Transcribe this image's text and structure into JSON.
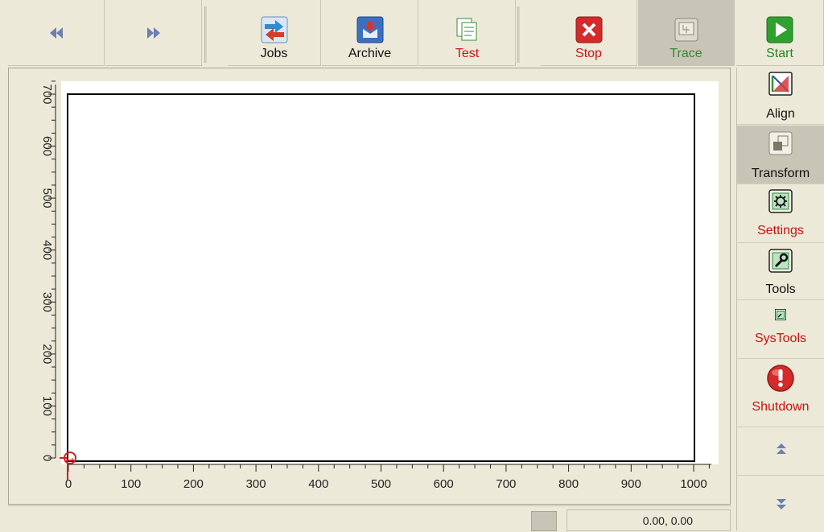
{
  "toolbar": {
    "buttons": [
      {
        "label": "Jobs",
        "color": "#111111",
        "icon": "jobs-icon"
      },
      {
        "label": "Archive",
        "color": "#111111",
        "icon": "archive-icon"
      },
      {
        "label": "Test",
        "color": "#cc1111",
        "icon": "test-icon"
      },
      {
        "label": "Stop",
        "color": "#cc1111",
        "icon": "stop-icon"
      },
      {
        "label": "Trace",
        "color": "#338833",
        "icon": "trace-icon"
      },
      {
        "label": "Start",
        "color": "#228822",
        "icon": "start-icon"
      }
    ],
    "nav": [
      "rewind-icon",
      "fast-forward-icon"
    ]
  },
  "side": {
    "buttons": [
      {
        "label": "Align",
        "color": "#111111",
        "icon": "align-icon"
      },
      {
        "label": "Transform",
        "color": "#111111",
        "icon": "transform-icon"
      },
      {
        "label": "Settings",
        "color": "#cc1111",
        "icon": "settings-icon"
      },
      {
        "label": "Tools",
        "color": "#111111",
        "icon": "tools-icon"
      },
      {
        "label": "SysTools",
        "color": "#cc1111",
        "icon": "systools-icon"
      },
      {
        "label": "Shutdown",
        "color": "#cc1111",
        "icon": "shutdown-icon"
      }
    ],
    "scroll": [
      "scroll-up-icon",
      "scroll-down-icon"
    ]
  },
  "ruler": {
    "x_labels": [
      "0",
      "100",
      "200",
      "300",
      "400",
      "500",
      "600",
      "700",
      "800",
      "900",
      "1000"
    ],
    "y_labels": [
      "0",
      "100",
      "200",
      "300",
      "400",
      "500",
      "600",
      "700"
    ]
  },
  "status": {
    "coords": "0.00, 0.00"
  }
}
